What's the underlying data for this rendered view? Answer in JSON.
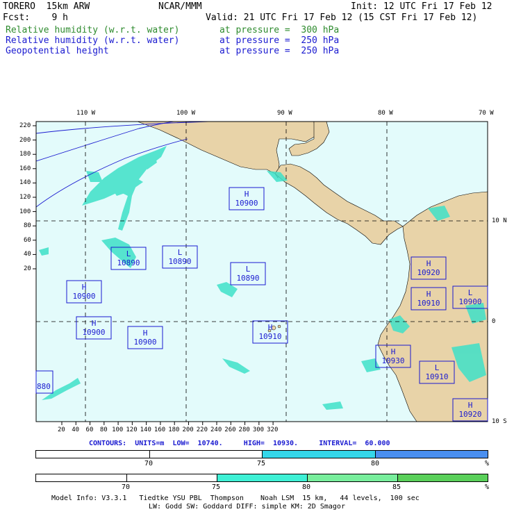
{
  "header": {
    "model": "TORERO  15km ARW",
    "org": "NCAR/MMM",
    "init": "Init: 12 UTC Fri 17 Feb 12",
    "fcst": "Fcst:    9 h",
    "valid": "Valid: 21 UTC Fri 17 Feb 12 (15 CST Fri 17 Feb 12)"
  },
  "fields": [
    {
      "name": "Relative humidity (w.r.t. water)",
      "level": "at pressure =  300 hPa",
      "color": "#2e8b2e"
    },
    {
      "name": "Relative humidity (w.r.t. water)",
      "level": "at pressure =  250 hPa",
      "color": "#1a1ad0"
    },
    {
      "name": "Geopotential height",
      "level": "at pressure =  250 hPa",
      "color": "#1a1ad0"
    }
  ],
  "map": {
    "ocean_color": "#e3fbfb",
    "land_color": "#e8d3a8",
    "lon_labels": [
      "110 W",
      "100 W",
      "90 W",
      "80 W",
      "70 W"
    ],
    "lat_labels": [
      "10 N",
      "0",
      "10 S"
    ],
    "x_ticks": [
      "20",
      "40",
      "60",
      "80",
      "100",
      "120",
      "140",
      "160",
      "180",
      "200",
      "220",
      "240",
      "260",
      "280",
      "300",
      "320"
    ],
    "y_ticks": [
      "220",
      "200",
      "180",
      "160",
      "140",
      "120",
      "100",
      "80",
      "60",
      "40",
      "20"
    ],
    "pressure_centers": [
      {
        "type": "H",
        "value": "10900"
      },
      {
        "type": "L",
        "value": "10890"
      },
      {
        "type": "L",
        "value": "10890"
      },
      {
        "type": "L",
        "value": "10890"
      },
      {
        "type": "H",
        "value": "10900"
      },
      {
        "type": "H",
        "value": "10900"
      },
      {
        "type": "H",
        "value": "10900"
      },
      {
        "type": "H",
        "value": "10910"
      },
      {
        "type": "H",
        "value": "10920"
      },
      {
        "type": "H",
        "value": "10910"
      },
      {
        "type": "L",
        "value": "10900"
      },
      {
        "type": "H",
        "value": "10930"
      },
      {
        "type": "L",
        "value": "10910"
      },
      {
        "type": "H",
        "value": "10920"
      },
      {
        "type": "",
        "value": "880"
      }
    ]
  },
  "contours": {
    "label": "CONTOURS:",
    "units": "UNITS=m",
    "low": "LOW=  10740.",
    "high": "HIGH=  10930.",
    "interval": "INTERVAL=  60.000"
  },
  "colorbars": [
    {
      "labels": [
        "70",
        "75",
        "80",
        "%"
      ],
      "segments": [
        {
          "from": 0,
          "to": 0.5,
          "color": "#ffffff"
        },
        {
          "from": 0.5,
          "to": 0.75,
          "color": "#35d7ea"
        },
        {
          "from": 0.75,
          "to": 1.0,
          "color": "#4a8ff0"
        }
      ]
    },
    {
      "labels": [
        "70",
        "75",
        "80",
        "85",
        "%"
      ],
      "segments": [
        {
          "from": 0,
          "to": 0.4,
          "color": "#ffffff"
        },
        {
          "from": 0.4,
          "to": 0.6,
          "color": "#3ef0d5"
        },
        {
          "from": 0.6,
          "to": 0.8,
          "color": "#78ee9c"
        },
        {
          "from": 0.8,
          "to": 1.0,
          "color": "#5ad05a"
        }
      ]
    }
  ],
  "footer": {
    "line1": "Model Info: V3.3.1   Tiedtke YSU PBL  Thompson    Noah LSM  15 km,   44 levels,  100 sec",
    "line2": "LW: Godd SW: Goddard DIFF: simple KM: 2D Smagor"
  }
}
